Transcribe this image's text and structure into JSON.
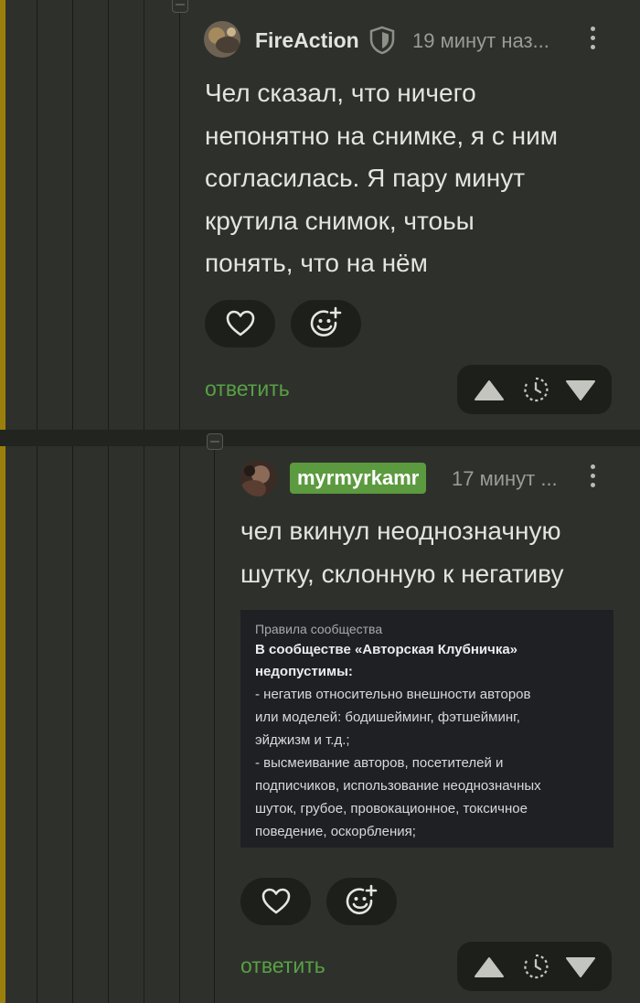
{
  "comments": [
    {
      "username": "FireAction",
      "timestamp": "19 минут наз...",
      "avatar_icon": "avatar-fireaction",
      "badge_icon": "shield-icon",
      "text_lines": [
        "Чел сказал, что ничего",
        "непонятно на снимке, я с ним",
        "согласилась. Я пару минут",
        "крутила снимок, чтоьы",
        "понять, что на нём"
      ],
      "reply_label": "ответить"
    },
    {
      "username": "myrmyrkamr",
      "timestamp": "17 минут ...",
      "avatar_icon": "avatar-myrmyrkamr",
      "username_badge_color": "#5c9a3f",
      "text_lines": [
        "чел вкинул неоднозначную",
        "шутку, склонную к негативу"
      ],
      "reply_label": "ответить",
      "attachment": {
        "title": "Правила сообщества",
        "heading_lines": [
          "В сообществе «Авторская Клубничка»",
          "недопустимы:"
        ],
        "lines": [
          "- негатив относительно внешности авторов",
          "или моделей: бодишейминг, фэтшейминг,",
          "эйджизм и т.д.;",
          "- высмеивание авторов, посетителей и",
          "подписчиков, использование неоднозначных",
          "шуток, грубое, провокационное, токсичное",
          "поведение, оскорбления;"
        ]
      }
    }
  ],
  "colors": {
    "background": "#2e312b",
    "thread_marker": "#9a7f0c",
    "reply_link": "#58a046",
    "pill_background": "#1d1f1b"
  },
  "icons": [
    "heart-icon",
    "add-reaction-icon",
    "upvote-icon",
    "rating-timer-icon",
    "downvote-icon",
    "more-icon",
    "collapse-icon"
  ]
}
